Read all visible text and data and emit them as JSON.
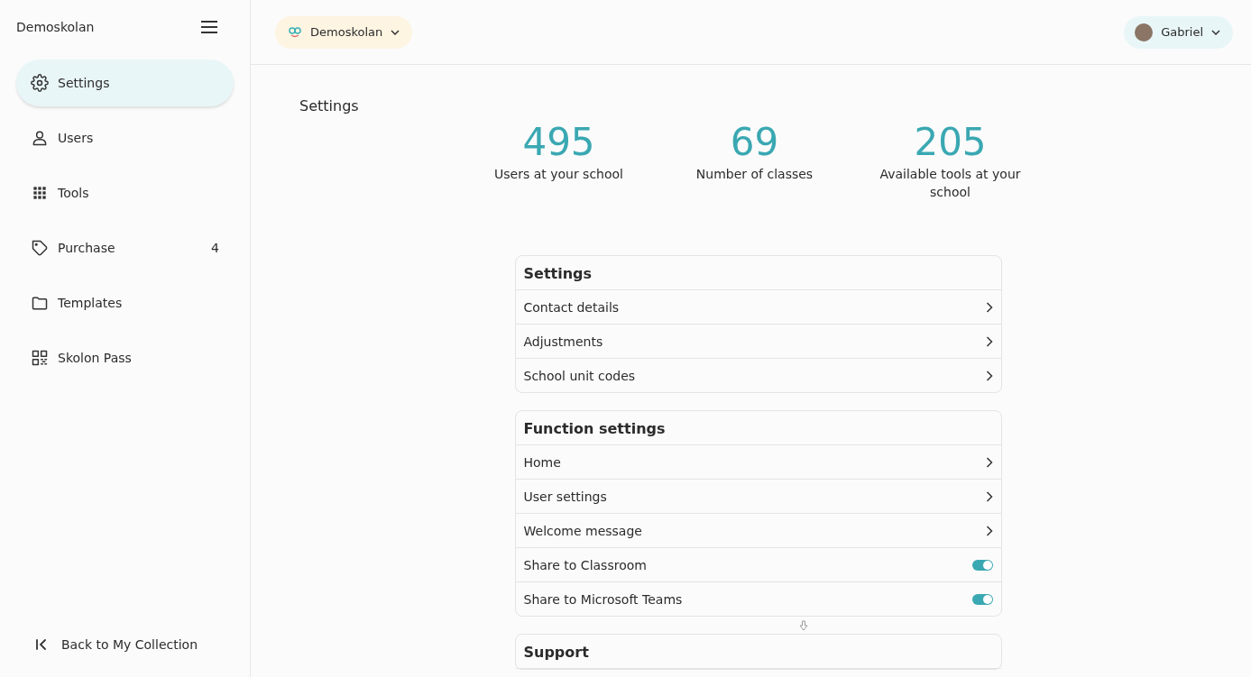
{
  "sidebar": {
    "title": "Demoskolan",
    "items": [
      {
        "label": "Settings",
        "selected": true
      },
      {
        "label": "Users",
        "selected": false
      },
      {
        "label": "Tools",
        "selected": false
      },
      {
        "label": "Purchase",
        "selected": false,
        "count": "4"
      },
      {
        "label": "Templates",
        "selected": false
      },
      {
        "label": "Skolon Pass",
        "selected": false
      }
    ],
    "footer_link": "Back to My Collection"
  },
  "topbar": {
    "school_selector": "Demoskolan",
    "user_menu": "Gabriel"
  },
  "page_title": "Settings",
  "stats": [
    {
      "value": "495",
      "label": "Users at your school"
    },
    {
      "value": "69",
      "label": "Number of classes"
    },
    {
      "value": "205",
      "label": "Available tools at your school"
    }
  ],
  "sections": [
    {
      "title": "Settings",
      "rows": [
        {
          "kind": "link",
          "label": "Contact details"
        },
        {
          "kind": "link",
          "label": "Adjustments"
        },
        {
          "kind": "link",
          "label": "School unit codes"
        }
      ]
    },
    {
      "title": "Function settings",
      "rows": [
        {
          "kind": "link",
          "label": "Home"
        },
        {
          "kind": "link",
          "label": "User settings"
        },
        {
          "kind": "link",
          "label": "Welcome message"
        },
        {
          "kind": "toggle",
          "label": "Share to Classroom",
          "on": true
        },
        {
          "kind": "toggle",
          "label": "Share to Microsoft Teams",
          "on": true
        }
      ]
    },
    {
      "title": "Support"
    }
  ]
}
